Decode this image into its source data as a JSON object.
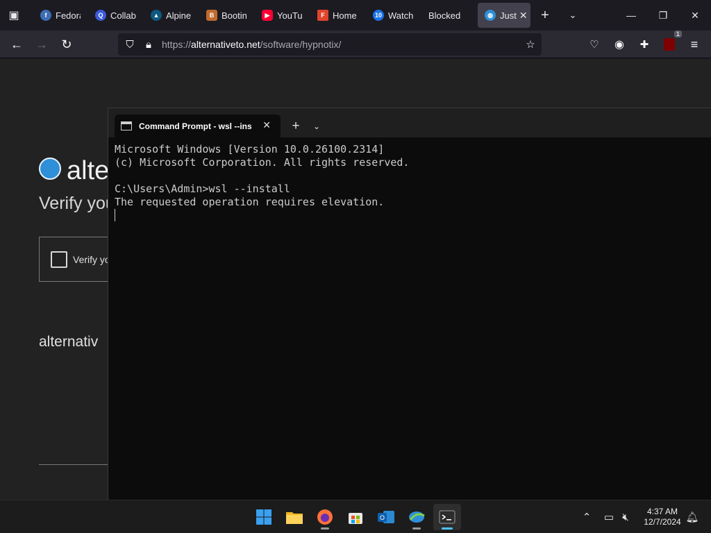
{
  "browser": {
    "tabs": [
      {
        "label": "Fedora",
        "icon": "fedora-icon",
        "color": "#3c6eb4"
      },
      {
        "label": "Collab",
        "icon": "collab-icon",
        "color": "#3b5bdb"
      },
      {
        "label": "Alpine",
        "icon": "alpine-icon",
        "color": "#0d597f"
      },
      {
        "label": "Bootin",
        "icon": "booting-icon",
        "color": "#c06a2d"
      },
      {
        "label": "YouTu",
        "icon": "youtube-icon",
        "color": "#ff0033"
      },
      {
        "label": "Home",
        "icon": "home-site-icon",
        "color": "#e0442c"
      },
      {
        "label": "Watch",
        "icon": "watch-icon",
        "color": "#1a73e8"
      },
      {
        "label": "Blocked",
        "icon": "",
        "color": ""
      },
      {
        "label": "Just",
        "icon": "alternativeto-icon",
        "color": "#2f8fd8",
        "active": true
      }
    ],
    "url_prefix": "https://",
    "url_host": "alternativeto.net",
    "url_path": "/software/hypnotix/",
    "extension_badge": "1"
  },
  "webpage": {
    "site_name": "alte",
    "verify_heading": "Verify you",
    "captcha_label": "Verify yo",
    "domain_text": "alternativ"
  },
  "terminal": {
    "tab_title": "Command Prompt - wsl  --ins",
    "lines": [
      "Microsoft Windows [Version 10.0.26100.2314]",
      "(c) Microsoft Corporation. All rights reserved.",
      "",
      "C:\\Users\\Admin>wsl --install",
      "The requested operation requires elevation."
    ]
  },
  "taskbar": {
    "time": "4:37 AM",
    "date": "12/7/2024"
  }
}
